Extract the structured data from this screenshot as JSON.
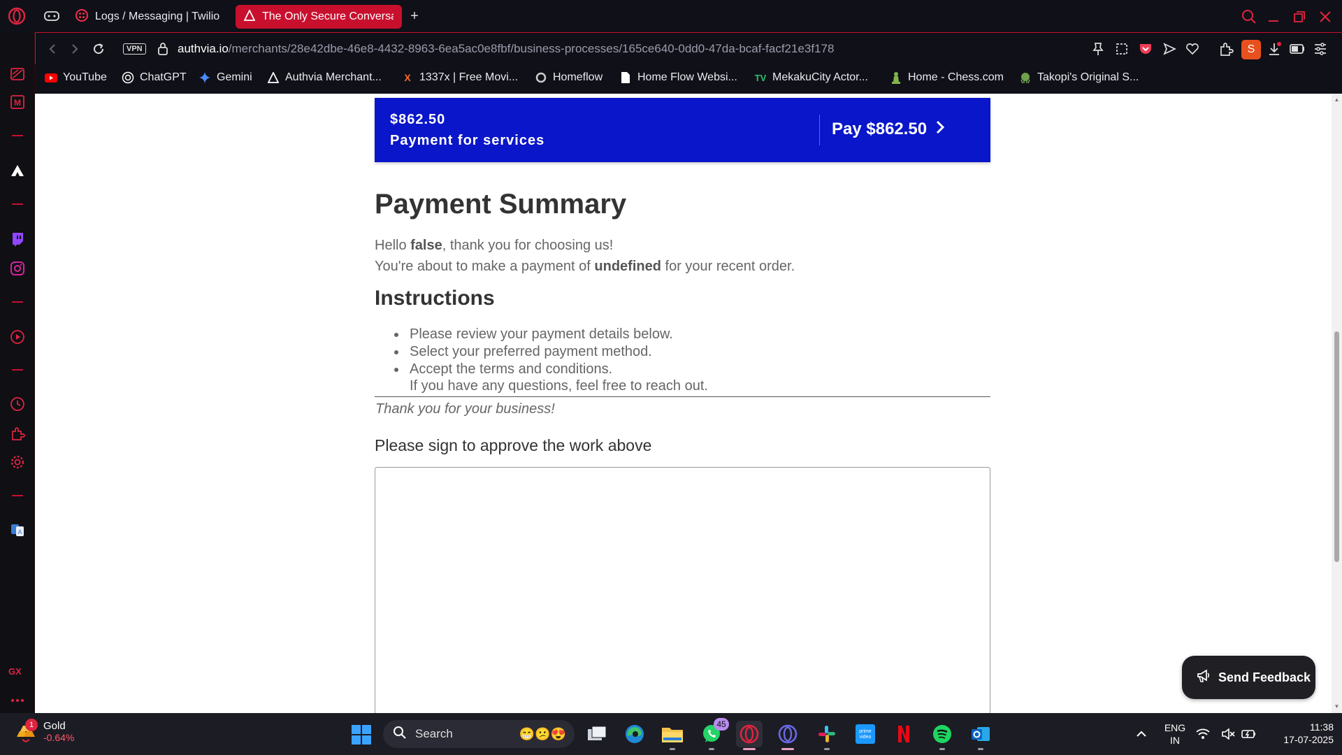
{
  "browser": {
    "tabs": [
      {
        "title": "Logs / Messaging | Twilio",
        "active": false
      },
      {
        "title": "The Only Secure Conversations",
        "active": true
      }
    ],
    "vpn_label": "VPN",
    "url": {
      "host": "authvia.io",
      "path": "/merchants/28e42dbe-46e8-4432-8963-6ea5ac0e8fbf/business-processes/165ce640-0dd0-47da-bcaf-facf21e3f178"
    },
    "profile_initial": "S",
    "sidebar_gx_label": "GX",
    "accent_color": "#c8102e"
  },
  "bookmarks": [
    {
      "label": "YouTube",
      "icon": "youtube-icon"
    },
    {
      "label": "ChatGPT",
      "icon": "chatgpt-icon"
    },
    {
      "label": "Gemini",
      "icon": "gemini-icon"
    },
    {
      "label": "Authvia Merchant...",
      "icon": "authvia-icon"
    },
    {
      "label": "1337x | Free Movi...",
      "icon": "x-icon"
    },
    {
      "label": "Homeflow",
      "icon": "homeflow-icon"
    },
    {
      "label": "Home Flow Websi...",
      "icon": "page-icon"
    },
    {
      "label": "MekakuCity Actor...",
      "icon": "tv-icon"
    },
    {
      "label": "Home - Chess.com",
      "icon": "chess-icon"
    },
    {
      "label": "Takopi's Original S...",
      "icon": "takopi-icon"
    }
  ],
  "page": {
    "paybar": {
      "amount": "$862.50",
      "description": "Payment for services",
      "pay_button": "Pay $862.50",
      "color": "#0a16c9"
    },
    "summary_title": "Payment Summary",
    "greeting": {
      "hello": "Hello ",
      "name": "false",
      "thanks": ", thank you for choosing us!",
      "line2_start": "You're about to make a payment of ",
      "line2_amount": "undefined",
      "line2_end": " for your recent order."
    },
    "instructions_title": "Instructions",
    "instructions": [
      "Please review your payment details below.",
      "Select your preferred payment method.",
      "Accept the terms and conditions."
    ],
    "instructions_note": "If you have any questions, feel free to reach out.",
    "thank_you": "Thank you for your business!",
    "sign_heading": "Please sign to approve the work above",
    "feedback_button": "Send Feedback"
  },
  "taskbar": {
    "stock_name": "Gold",
    "stock_change": "-0.64%",
    "stock_badge": "1",
    "search_placeholder": "Search",
    "whatsapp_count": "45",
    "lang_top": "ENG",
    "lang_bottom": "IN",
    "time": "11:38",
    "date": "17-07-2025"
  }
}
